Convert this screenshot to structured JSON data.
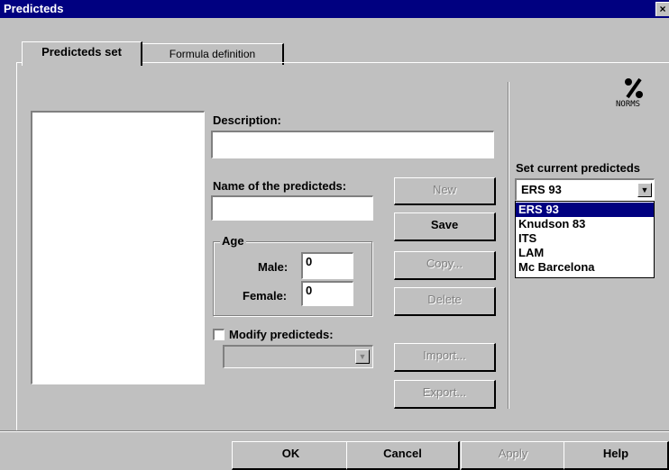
{
  "window": {
    "title": "Predicteds",
    "close_glyph": "×"
  },
  "tabs": [
    {
      "label": "Predicteds set",
      "active": true
    },
    {
      "label": "Formula definition",
      "active": false
    }
  ],
  "form": {
    "description_label": "Description:",
    "description_value": "",
    "name_label": "Name of the predicteds:",
    "name_value": "",
    "age_group": "Age",
    "male_label": "Male:",
    "male_value": "0",
    "female_label": "Female:",
    "female_value": "0",
    "modify_label": "Modify predicteds:",
    "modify_checked": false,
    "modify_select_value": ""
  },
  "side_buttons": {
    "new": "New",
    "save": "Save",
    "copy": "Copy...",
    "delete": "Delete",
    "import": "Import...",
    "export": "Export..."
  },
  "norms": {
    "icon": "percent-icon",
    "label": "NORMS"
  },
  "current_predicteds": {
    "label": "Set current predicteds",
    "selected": "ERS 93",
    "options": [
      "ERS 93",
      "Knudson 83",
      "ITS",
      "LAM",
      "Mc Barcelona"
    ]
  },
  "footer": {
    "ok": "OK",
    "cancel": "Cancel",
    "apply": "Apply",
    "help": "Help"
  },
  "colors": {
    "face": "#c0c0c0",
    "titlebar": "#000080",
    "highlight": "#000080"
  }
}
